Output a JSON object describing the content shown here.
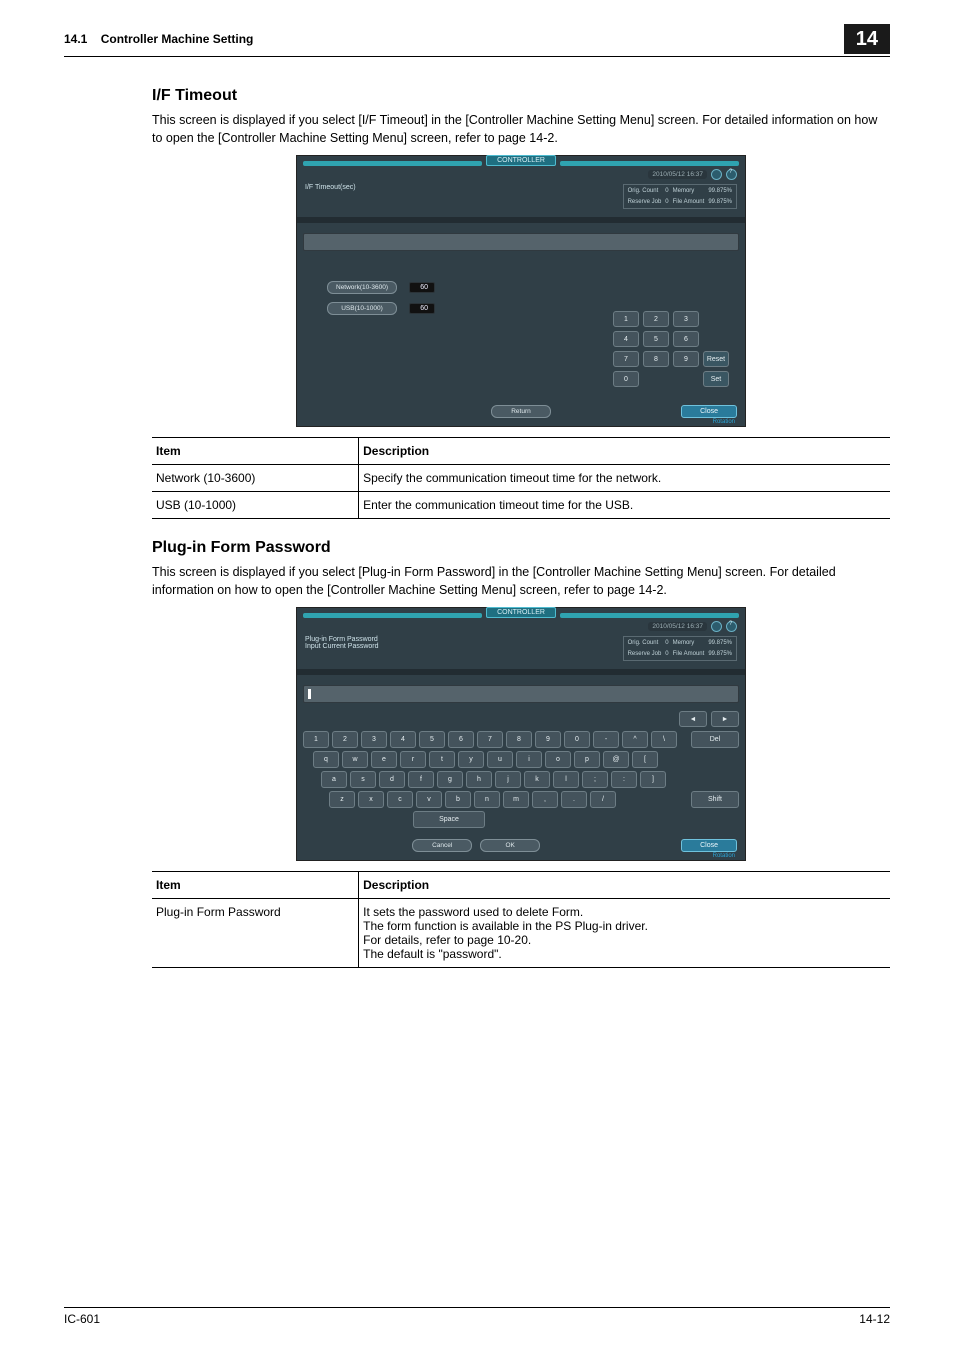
{
  "header": {
    "section_number": "14.1",
    "section_title": "Controller Machine Setting",
    "chapter": "14"
  },
  "sect1": {
    "title": "I/F Timeout",
    "intro": "This screen is displayed if you select [I/F Timeout] in the [Controller Machine Setting Menu] screen. For detailed information on how to open the [Controller Machine Setting Menu] screen, refer to page 14-2."
  },
  "panel1": {
    "tab": "CONTROLLER",
    "datetime": "2010/05/12 16:37",
    "title": "I/F Timeout(sec)",
    "status": {
      "l1a": "Orig. Count",
      "l1b": "0",
      "l1c": "Memory",
      "l1d": "99.875%",
      "l2a": "Reserve Job",
      "l2b": "0",
      "l2c": "File Amount",
      "l2d": "99.875%"
    },
    "fields": {
      "network_label": "Network(10-3600)",
      "network_value": "60",
      "usb_label": "USB(10-1000)",
      "usb_value": "60"
    },
    "numpad": {
      "k1": "1",
      "k2": "2",
      "k3": "3",
      "k4": "4",
      "k5": "5",
      "k6": "6",
      "k7": "7",
      "k8": "8",
      "k9": "9",
      "k0": "0",
      "reset": "Reset",
      "set": "Set"
    },
    "return_btn": "Return",
    "close_btn": "Close",
    "rotation": "Rotation"
  },
  "table1": {
    "head_item": "Item",
    "head_desc": "Description",
    "r1a": "Network (10-3600)",
    "r1b": "Specify the communication timeout time for the network.",
    "r2a": "USB (10-1000)",
    "r2b": "Enter the communication timeout time for the USB."
  },
  "sect2": {
    "title": "Plug-in Form Password",
    "intro": "This screen is displayed if you select [Plug-in Form Password] in the [Controller Machine Setting Menu] screen. For detailed information on how to open the [Controller Machine Setting Menu] screen, refer to page 14-2."
  },
  "panel2": {
    "tab": "CONTROLLER",
    "datetime": "2010/05/12 16:37",
    "title_l1": "Plug-in Form Password",
    "title_l2": "Input Current Password",
    "status": {
      "l1a": "Orig. Count",
      "l1b": "0",
      "l1c": "Memory",
      "l1d": "99.875%",
      "l2a": "Reserve Job",
      "l2b": "0",
      "l2c": "File Amount",
      "l2d": "99.875%"
    },
    "nav_left": "◄",
    "nav_right": "►",
    "kbd": {
      "row1": [
        "1",
        "2",
        "3",
        "4",
        "5",
        "6",
        "7",
        "8",
        "9",
        "0",
        "-",
        "^",
        "\\"
      ],
      "del": "Del",
      "row2": [
        "q",
        "w",
        "e",
        "r",
        "t",
        "y",
        "u",
        "i",
        "o",
        "p",
        "@",
        "["
      ],
      "row3": [
        "a",
        "s",
        "d",
        "f",
        "g",
        "h",
        "j",
        "k",
        "l",
        ";",
        ":",
        "]"
      ],
      "row4": [
        "z",
        "x",
        "c",
        "v",
        "b",
        "n",
        "m",
        ",",
        ".",
        "/"
      ],
      "shift": "Shift",
      "space": "Space"
    },
    "cancel": "Cancel",
    "ok": "OK",
    "close": "Close",
    "rotation": "Rotation"
  },
  "table2": {
    "head_item": "Item",
    "head_desc": "Description",
    "r1a": "Plug-in Form Password",
    "r1b_l1": "It sets the password used to delete Form.",
    "r1b_l2": "The form function is available in the PS Plug-in driver.",
    "r1b_l3": "For details, refer to page 10-20.",
    "r1b_l4": "The default is \"password\"."
  },
  "footer": {
    "product": "IC-601",
    "page": "14-12"
  }
}
